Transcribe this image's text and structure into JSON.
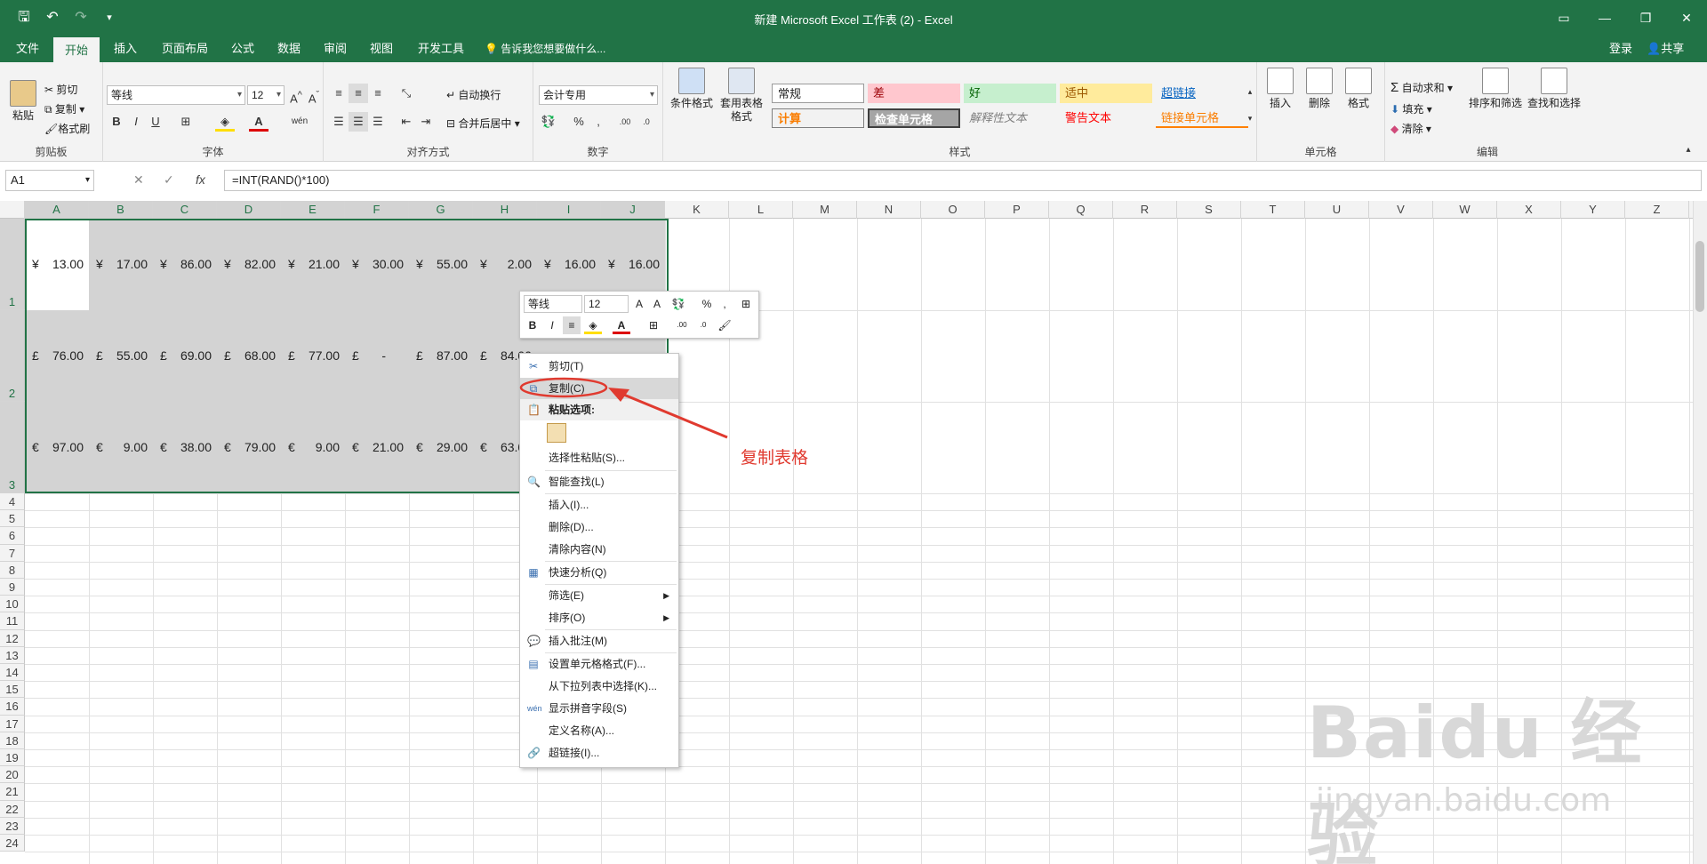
{
  "window": {
    "title": "新建 Microsoft Excel 工作表 (2) - Excel"
  },
  "qat": [
    "save-icon",
    "undo-icon",
    "redo-icon",
    "customize-icon"
  ],
  "tabs": [
    "文件",
    "开始",
    "插入",
    "页面布局",
    "公式",
    "数据",
    "审阅",
    "视图",
    "开发工具"
  ],
  "tell_me": "告诉我您想要做什么...",
  "sign_in": "登录",
  "share": "共享",
  "ribbon": {
    "clipboard": {
      "paste": "粘贴",
      "cut": "剪切",
      "copy": "复制",
      "format_painter": "格式刷",
      "label": "剪贴板"
    },
    "font": {
      "name": "等线",
      "size": "12",
      "label": "字体",
      "bold": "B",
      "italic": "I",
      "underline": "U"
    },
    "alignment": {
      "wrap": "自动换行",
      "merge": "合并后居中",
      "label": "对齐方式"
    },
    "number": {
      "format": "会计专用",
      "label": "数字",
      "percent": "%"
    },
    "styles": {
      "conditional": "条件格式",
      "table": "套用表格格式",
      "items": [
        "常规",
        "差",
        "好",
        "适中",
        "超链接",
        "计算",
        "检查单元格",
        "解释性文本",
        "警告文本",
        "链接单元格"
      ],
      "label": "样式"
    },
    "cells": {
      "insert": "插入",
      "delete": "删除",
      "format": "格式",
      "label": "单元格"
    },
    "editing": {
      "autosum": "自动求和",
      "fill": "填充",
      "clear": "清除",
      "sort": "排序和筛选",
      "find": "查找和选择",
      "label": "编辑"
    }
  },
  "formula_bar": {
    "namebox": "A1",
    "formula": "=INT(RAND()*100)"
  },
  "columns": [
    "A",
    "B",
    "C",
    "D",
    "E",
    "F",
    "G",
    "H",
    "I",
    "J",
    "K",
    "L",
    "M",
    "N",
    "O",
    "P",
    "Q",
    "R",
    "S",
    "T",
    "U",
    "V",
    "W",
    "X",
    "Y",
    "Z"
  ],
  "rows": [
    "1",
    "2",
    "3",
    "4",
    "5",
    "6",
    "7",
    "8",
    "9",
    "10",
    "11",
    "12",
    "13",
    "14",
    "15",
    "16",
    "17",
    "18",
    "19",
    "20",
    "21",
    "22",
    "23",
    "24"
  ],
  "cells": {
    "row1": {
      "currency": "¥",
      "values": [
        "13.00",
        "17.00",
        "86.00",
        "82.00",
        "21.00",
        "30.00",
        "55.00",
        "2.00",
        "16.00",
        "16.00"
      ]
    },
    "row2": {
      "currency": "£",
      "values": [
        "76.00",
        "55.00",
        "69.00",
        "68.00",
        "77.00",
        "-",
        "87.00",
        "84.00",
        "",
        ""
      ]
    },
    "row3": {
      "currency": "€",
      "values": [
        "97.00",
        "9.00",
        "38.00",
        "79.00",
        "9.00",
        "21.00",
        "29.00",
        "63.00",
        "",
        ""
      ]
    }
  },
  "mini_toolbar": {
    "font": "等线",
    "size": "12"
  },
  "context_menu": [
    "剪切(T)",
    "复制(C)",
    "粘贴选项:",
    "选择性粘贴(S)...",
    "智能查找(L)",
    "插入(I)...",
    "删除(D)...",
    "清除内容(N)",
    "快速分析(Q)",
    "筛选(E)",
    "排序(O)",
    "插入批注(M)",
    "设置单元格格式(F)...",
    "从下拉列表中选择(K)...",
    "显示拼音字段(S)",
    "定义名称(A)...",
    "超链接(I)..."
  ],
  "annotation": "复制表格",
  "watermark": {
    "logo": "Bai du 经验",
    "url": "jingyan.baidu.com"
  },
  "colors": {
    "accent": "#217346",
    "annotation": "#e03a2f",
    "selection": "#d3d3d3"
  }
}
